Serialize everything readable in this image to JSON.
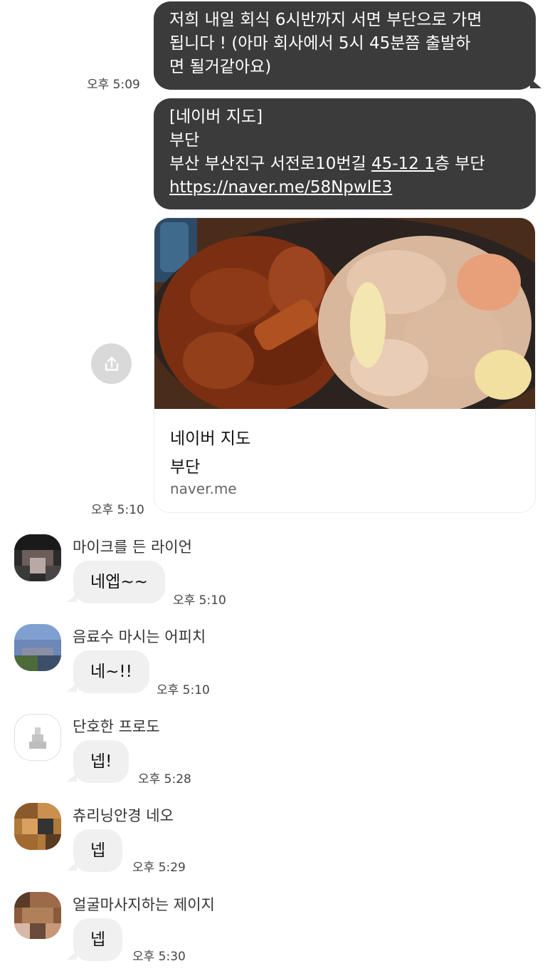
{
  "messages_out": [
    {
      "lines": [
        "저희 내일 회식 6시반까지 서면 부단으로 가면",
        "됩니다 ! (아마 회사에서 5시 45분쯤 출발하",
        "면 될거같아요)"
      ],
      "time": "오후 5:09"
    },
    {
      "line1": "[네이버 지도]",
      "line2": "부단",
      "line3_prefix": "부산 부산진구 서전로10번길 ",
      "line3_link": "45-12 1",
      "line3_suffix": "층 부단",
      "url": "https://naver.me/58NpwlE3"
    }
  ],
  "link_card": {
    "title": "네이버 지도",
    "subtitle": "부단",
    "host": "naver.me",
    "time": "오후 5:10",
    "share_icon": "share-icon"
  },
  "messages_in": [
    {
      "sender": "마이크를 든 라이언",
      "text": "네엡~~",
      "time": "오후 5:10"
    },
    {
      "sender": "음료수 마시는 어피치",
      "text": "네~!!",
      "time": "오후 5:10"
    },
    {
      "sender": "단호한 프로도",
      "text": "넵!",
      "time": "오후 5:28"
    },
    {
      "sender": "츄리닝안경 네오",
      "text": "넵",
      "time": "오후 5:29"
    },
    {
      "sender": "얼굴마사지하는 제이지",
      "text": "넵",
      "time": "오후 5:30"
    }
  ],
  "colors": {
    "outgoing_bubble": "#3b3b3c",
    "incoming_bubble": "#f0f0f0",
    "background": "#ffffff"
  }
}
